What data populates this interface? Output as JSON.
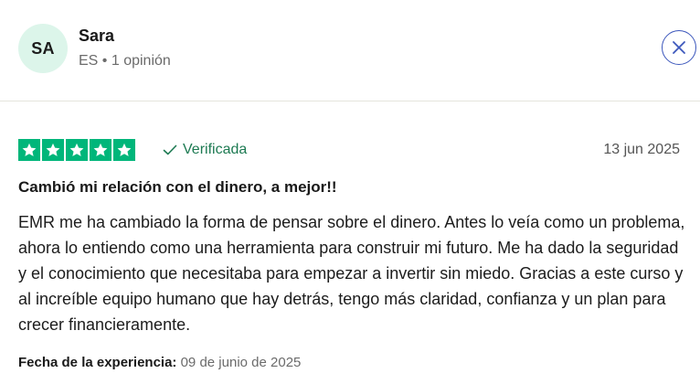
{
  "reviewer": {
    "initials": "SA",
    "name": "Sara",
    "country": "ES",
    "separator": "•",
    "review_count": "1 opinión"
  },
  "review": {
    "rating": 5,
    "star_color": "#00b67a",
    "verified_label": "Verificada",
    "date": "13 jun 2025",
    "title": "Cambió mi relación con el dinero, a mejor!!",
    "body": "EMR me ha cambiado la forma de pensar sobre el dinero. Antes lo veía como un problema, ahora lo entiendo como una herramienta para construir mi futuro. Me ha dado la seguridad y el conocimiento que necesitaba para empezar a invertir sin miedo. Gracias a este curso y al increíble equipo humano que hay detrás, tengo más claridad, confianza y un plan para crecer financieramente.",
    "experience_label": "Fecha de la experiencia:",
    "experience_date": "09 de junio de 2025"
  },
  "icons": {
    "close": "close-icon",
    "check": "check-icon",
    "star": "star-icon"
  }
}
